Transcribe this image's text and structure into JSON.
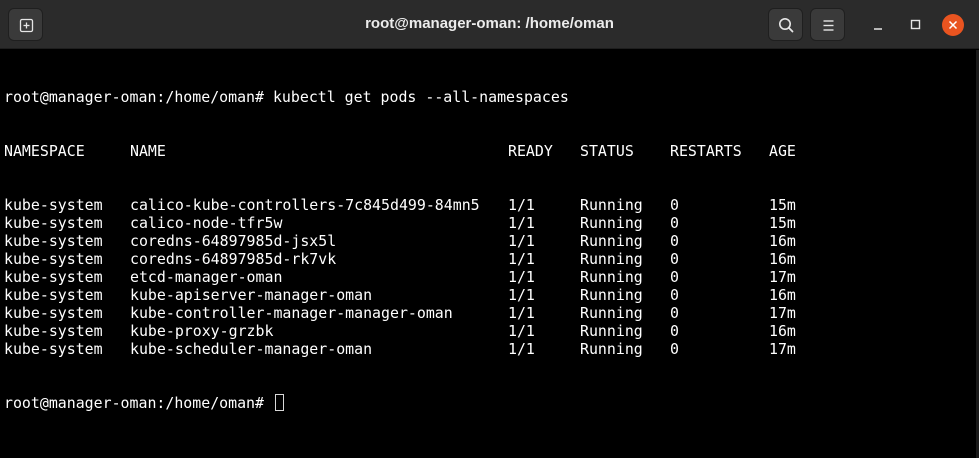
{
  "window": {
    "title": "root@manager-oman: /home/oman"
  },
  "icons": {
    "new_tab": "new-tab-icon",
    "search": "search-icon",
    "menu": "hamburger-menu-icon",
    "minimize": "minimize-icon",
    "maximize": "maximize-icon",
    "close": "close-icon"
  },
  "colors": {
    "titlebar": "#2b2b2b",
    "terminal_bg": "#000000",
    "terminal_fg": "#ffffff",
    "close_button": "#e95420"
  },
  "terminal": {
    "prompt": "root@manager-oman:/home/oman#",
    "command": "kubectl get pods --all-namespaces",
    "headers": {
      "namespace": "NAMESPACE",
      "name": "NAME",
      "ready": "READY",
      "status": "STATUS",
      "restarts": "RESTARTS",
      "age": "AGE"
    },
    "rows": [
      {
        "namespace": "kube-system",
        "name": "calico-kube-controllers-7c845d499-84mn5",
        "ready": "1/1",
        "status": "Running",
        "restarts": "0",
        "age": "15m"
      },
      {
        "namespace": "kube-system",
        "name": "calico-node-tfr5w",
        "ready": "1/1",
        "status": "Running",
        "restarts": "0",
        "age": "15m"
      },
      {
        "namespace": "kube-system",
        "name": "coredns-64897985d-jsx5l",
        "ready": "1/1",
        "status": "Running",
        "restarts": "0",
        "age": "16m"
      },
      {
        "namespace": "kube-system",
        "name": "coredns-64897985d-rk7vk",
        "ready": "1/1",
        "status": "Running",
        "restarts": "0",
        "age": "16m"
      },
      {
        "namespace": "kube-system",
        "name": "etcd-manager-oman",
        "ready": "1/1",
        "status": "Running",
        "restarts": "0",
        "age": "17m"
      },
      {
        "namespace": "kube-system",
        "name": "kube-apiserver-manager-oman",
        "ready": "1/1",
        "status": "Running",
        "restarts": "0",
        "age": "16m"
      },
      {
        "namespace": "kube-system",
        "name": "kube-controller-manager-manager-oman",
        "ready": "1/1",
        "status": "Running",
        "restarts": "0",
        "age": "17m"
      },
      {
        "namespace": "kube-system",
        "name": "kube-proxy-grzbk",
        "ready": "1/1",
        "status": "Running",
        "restarts": "0",
        "age": "16m"
      },
      {
        "namespace": "kube-system",
        "name": "kube-scheduler-manager-oman",
        "ready": "1/1",
        "status": "Running",
        "restarts": "0",
        "age": "17m"
      }
    ]
  }
}
